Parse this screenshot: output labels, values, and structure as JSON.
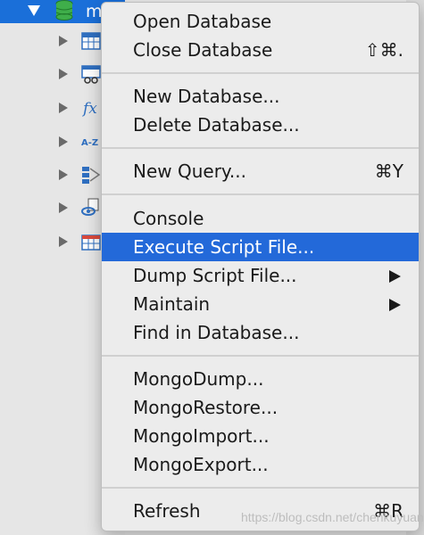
{
  "tree": {
    "selected_db_name": "m",
    "colors": {
      "selected": "#1a6fd9",
      "panel": "#e6e6e6"
    },
    "children_icons": [
      "table-icon",
      "view-icon",
      "function-icon",
      "sort-icon",
      "query-icon",
      "report-icon",
      "backup-icon"
    ]
  },
  "menu": {
    "highlight_color": "#2369d9",
    "items": [
      {
        "label": "Open Database",
        "shortcut": ""
      },
      {
        "label": "Close Database",
        "shortcut": "⇧⌘."
      },
      {
        "label": "New Database...",
        "shortcut": ""
      },
      {
        "label": "Delete Database...",
        "shortcut": ""
      },
      {
        "label": "New Query...",
        "shortcut": "⌘Y"
      },
      {
        "label": "Console",
        "shortcut": ""
      },
      {
        "label": "Execute Script File...",
        "shortcut": ""
      },
      {
        "label": "Dump Script File...",
        "shortcut": ""
      },
      {
        "label": "Maintain",
        "shortcut": ""
      },
      {
        "label": "Find in Database...",
        "shortcut": ""
      },
      {
        "label": "MongoDump...",
        "shortcut": ""
      },
      {
        "label": "MongoRestore...",
        "shortcut": ""
      },
      {
        "label": "MongoImport...",
        "shortcut": ""
      },
      {
        "label": "MongoExport...",
        "shortcut": ""
      },
      {
        "label": "Refresh",
        "shortcut": "⌘R"
      }
    ]
  },
  "watermark": "https://blog.csdn.net/chenkuyuanx"
}
